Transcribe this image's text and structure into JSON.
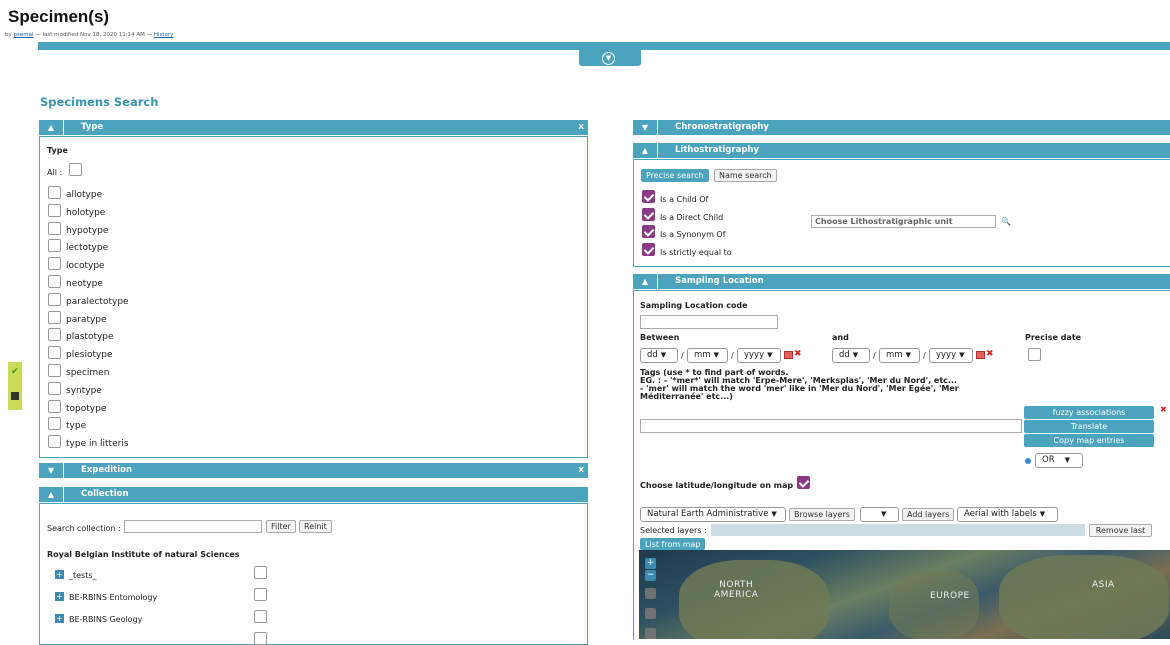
{
  "page": {
    "title": "Specimen(s)",
    "byline_prefix": "by",
    "author": "psemal",
    "byline_middle": "— last modified Nov 18, 2020 11:14 AM —",
    "history_link": "History",
    "section_title": "Specimens Search"
  },
  "type_panel": {
    "header": "Type",
    "close": "x",
    "heading": "Type",
    "all_label": "All :",
    "items": [
      "allotype",
      "holotype",
      "hypotype",
      "lectotype",
      "locotype",
      "neotype",
      "paralectotype",
      "paratype",
      "plastotype",
      "plesiotype",
      "specimen",
      "syntype",
      "topotype",
      "type",
      "type in litteris"
    ]
  },
  "expedition_panel": {
    "header": "Expedition",
    "close": "x"
  },
  "collection_panel": {
    "header": "Collection",
    "search_label": "Search collection :",
    "filter_btn": "Filter",
    "reinit_btn": "Reinit",
    "institution": "Royal Belgian Institute of natural Sciences",
    "items": [
      "_tests_",
      "BE-RBINS Entomology",
      "BE-RBINS Geology"
    ]
  },
  "chrono_panel": {
    "header": "Chronostratigraphy"
  },
  "litho_panel": {
    "header": "Lithostratigraphy",
    "tab_precise": "Precise search",
    "tab_name": "Name search",
    "options": [
      "Is a Child Of",
      "Is a Direct Child",
      "Is a Synonym Of",
      "Is strictly equal to"
    ],
    "unit_placeholder": "Choose Lithostratigraphic unit"
  },
  "sampling_panel": {
    "header": "Sampling Location",
    "code_label": "Sampling Location code",
    "between_label": "Between",
    "and_label": "and",
    "precise_date_label": "Precise date",
    "date_dd": "dd",
    "date_mm": "mm",
    "date_yyyy": "yyyy",
    "sep": "/",
    "tags_line1": "Tags (use * to find part of words.",
    "tags_line2": "EG. : - '*mer*' will match 'Erpe-Mere', 'Merksplas', 'Mer du Nord', etc...",
    "tags_line3": "- 'mer' will match the word 'mer' like in 'Mer du Nord', 'Mer Egée', 'Mer",
    "tags_line4": "Méditerranée' etc...)",
    "fuzzy_btn": "fuzzy associations",
    "translate_btn": "Translate",
    "copy_btn": "Copy map entries",
    "or_select": "OR",
    "choose_map_label": "Choose latitude/longitude on map",
    "layer_select": "Natural Earth Administrative",
    "browse_layers": "Browse layers",
    "add_layers": "Add layers",
    "aerial_select": "Aerial with labels",
    "selected_layers_label": "Selected layers :",
    "remove_last": "Remove last",
    "list_from_map": "List from map",
    "map_labels": {
      "north_america": "NORTH\nAMERICA",
      "north_line1": "NORTH",
      "north_line2": "AMERICA",
      "europe": "EUROPE",
      "asia": "ASIA"
    }
  },
  "colors": {
    "accent": "#4ba3bd",
    "checkbox_on": "#8b3a86",
    "side_tab": "#c8dc5a"
  }
}
